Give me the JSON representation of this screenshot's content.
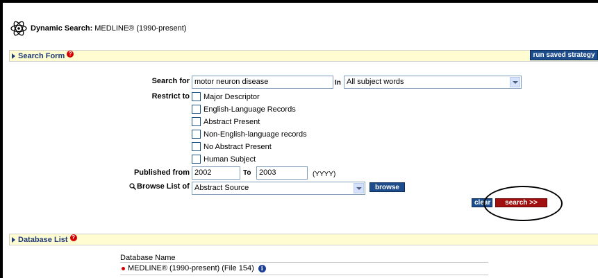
{
  "header": {
    "app_label": "Dynamic Search:",
    "database_label": "MEDLINE® (1990-present)",
    "logo_icon": "atom-icon"
  },
  "search_form": {
    "section_title": "Search Form",
    "help_icon": "help-icon",
    "saved_strategy_label": "run saved strategy",
    "search_for_label": "Search for",
    "search_for_value": "motor neuron disease",
    "in_label": "In",
    "in_selected": "All subject words",
    "restrict_to_label": "Restrict to",
    "restrictions": [
      {
        "label": "Major Descriptor",
        "checked": false
      },
      {
        "label": "English-Language Records",
        "checked": false
      },
      {
        "label": "Abstract Present",
        "checked": false
      },
      {
        "label": "Non-English-language records",
        "checked": false
      },
      {
        "label": "No Abstract Present",
        "checked": false
      },
      {
        "label": "Human Subject",
        "checked": false
      }
    ],
    "published_from_label": "Published from",
    "published_from_value": "2002",
    "to_label": "To",
    "to_value": "2003",
    "year_format": "(YYYY)",
    "browse_list_label": "Browse List of",
    "browse_list_selected": "Abstract Source",
    "browse_button_label": "browse",
    "clear_button_label": "clear",
    "search_button_label": "search >>"
  },
  "database_list": {
    "section_title": "Database List",
    "column_header": "Database Name",
    "databases": [
      {
        "name": "MEDLINE® (1990-present) (File 154)",
        "info_icon": "info-icon"
      }
    ]
  },
  "colors": {
    "section_bar_bg": "#fefcd0",
    "section_title": "#1e3a78",
    "button_blue": "#1c4c8c",
    "search_button_red": "#a01010",
    "help_red": "#d40000"
  }
}
